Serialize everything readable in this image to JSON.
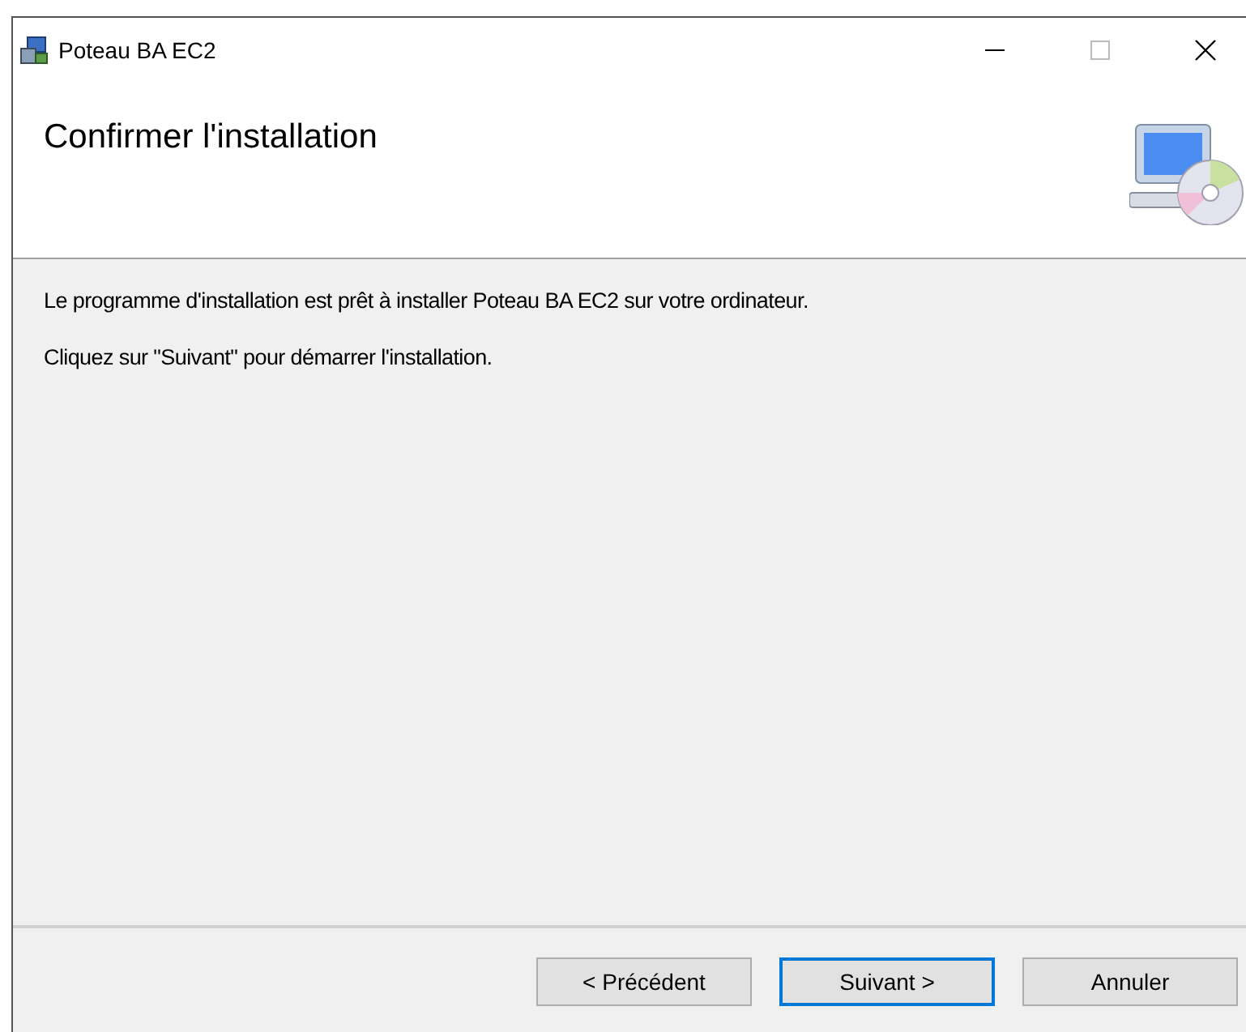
{
  "window": {
    "title": "Poteau BA EC2"
  },
  "header": {
    "title": "Confirmer l'installation"
  },
  "body": {
    "paragraphs": [
      "Le programme d'installation est prêt à installer Poteau BA EC2 sur votre ordinateur.",
      "Cliquez sur \"Suivant\" pour démarrer l'installation."
    ]
  },
  "buttons": [
    {
      "label": "< Précédent",
      "focused": false
    },
    {
      "label": "Suivant >",
      "focused": true
    },
    {
      "label": "Annuler",
      "focused": false
    }
  ]
}
